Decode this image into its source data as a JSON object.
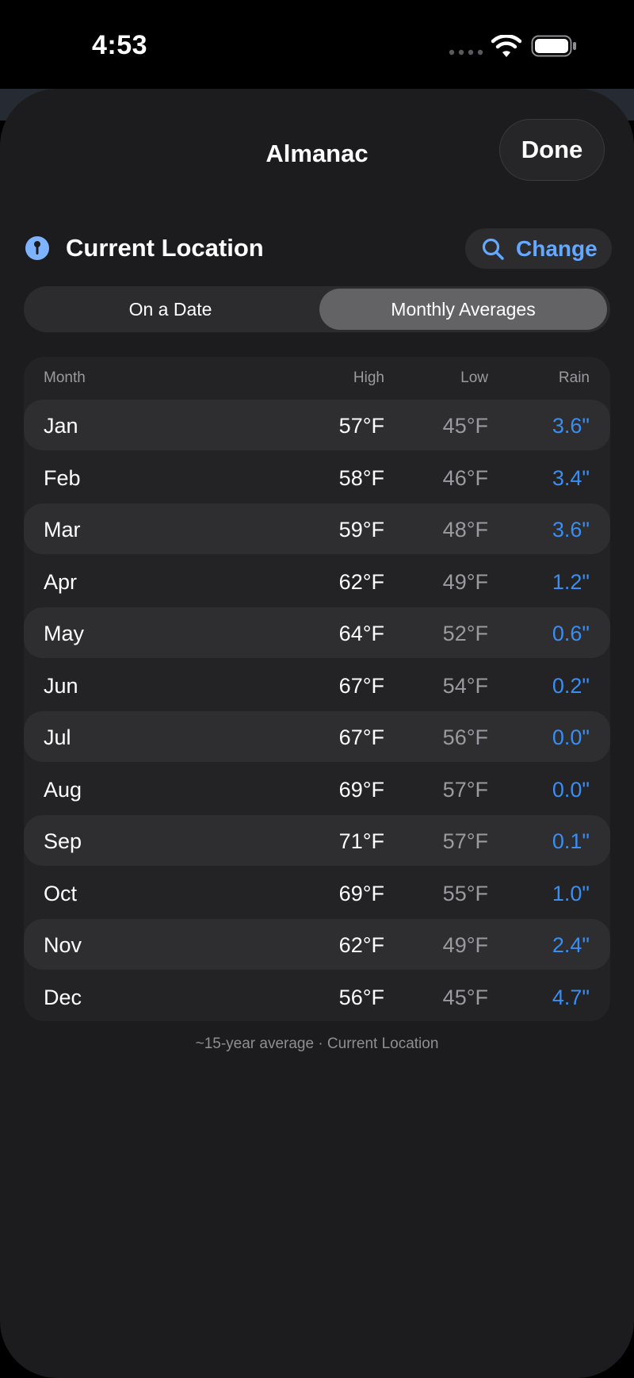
{
  "status_bar": {
    "time": "4:53"
  },
  "sheet": {
    "title": "Almanac",
    "done_label": "Done"
  },
  "location": {
    "label": "Current Location",
    "change_label": "Change"
  },
  "segments": {
    "on_a_date": "On a Date",
    "monthly_averages": "Monthly Averages",
    "selected": "Monthly Averages"
  },
  "table": {
    "headers": {
      "month": "Month",
      "high": "High",
      "low": "Low",
      "rain": "Rain"
    },
    "rows": [
      {
        "month": "Jan",
        "high": "57°F",
        "low": "45°F",
        "rain": "3.6\""
      },
      {
        "month": "Feb",
        "high": "58°F",
        "low": "46°F",
        "rain": "3.4\""
      },
      {
        "month": "Mar",
        "high": "59°F",
        "low": "48°F",
        "rain": "3.6\""
      },
      {
        "month": "Apr",
        "high": "62°F",
        "low": "49°F",
        "rain": "1.2\""
      },
      {
        "month": "May",
        "high": "64°F",
        "low": "52°F",
        "rain": "0.6\""
      },
      {
        "month": "Jun",
        "high": "67°F",
        "low": "54°F",
        "rain": "0.2\""
      },
      {
        "month": "Jul",
        "high": "67°F",
        "low": "56°F",
        "rain": "0.0\""
      },
      {
        "month": "Aug",
        "high": "69°F",
        "low": "57°F",
        "rain": "0.0\""
      },
      {
        "month": "Sep",
        "high": "71°F",
        "low": "57°F",
        "rain": "0.1\""
      },
      {
        "month": "Oct",
        "high": "69°F",
        "low": "55°F",
        "rain": "1.0\""
      },
      {
        "month": "Nov",
        "high": "62°F",
        "low": "49°F",
        "rain": "2.4\""
      },
      {
        "month": "Dec",
        "high": "56°F",
        "low": "45°F",
        "rain": "4.7\""
      }
    ]
  },
  "footnote": "~15-year average · Current Location",
  "colors": {
    "accent": "#64a8ff",
    "rain": "#3b8df0",
    "sheet_bg": "#1c1c1e"
  },
  "icons": {
    "pin": "location-pin-icon",
    "search": "search-icon",
    "wifi": "wifi-icon",
    "battery": "battery-icon",
    "cellular": "cellular-icon"
  }
}
